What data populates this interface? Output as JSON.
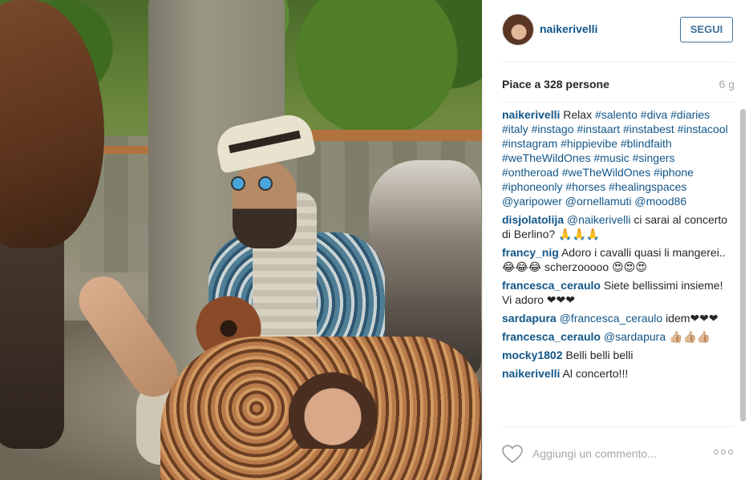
{
  "post": {
    "username": "naikerivelli",
    "follow_label": "SEGUI",
    "likes_label": "Piace a 328 persone",
    "age_label": "6 g"
  },
  "caption": {
    "user": "naikerivelli",
    "text": "Relax",
    "tags": "#salento #diva #diaries #italy #instago #instaart #instabest #instacool #instagram #hippievibe #blindfaith #weTheWildOnes #music #singers #ontheroad #weTheWildOnes #iphone #iphoneonly #horses #healingspaces @yaripower @ornellamuti @mood86"
  },
  "comments": [
    {
      "user": "disjolatolija",
      "mention": "@naikerivelli",
      "text": "ci sarai al concerto di Berlino? 🙏🙏🙏"
    },
    {
      "user": "francy_nig",
      "mention": "",
      "text": "Adoro i cavalli quasi li mangerei.. 😂😂😂 scherzooooo 😍😍😍"
    },
    {
      "user": "francesca_ceraulo",
      "mention": "",
      "text": "Siete bellissimi insieme! Vi adoro ❤❤❤"
    },
    {
      "user": "sardapura",
      "mention": "@francesca_ceraulo",
      "text": "idem❤❤❤"
    },
    {
      "user": "francesca_ceraulo",
      "mention": "@sardapura",
      "text": "👍🏼👍🏼👍🏼"
    },
    {
      "user": "mocky1802",
      "mention": "",
      "text": "Belli belli belli"
    },
    {
      "user": "naikerivelli",
      "mention": "",
      "text": "Al concerto!!!"
    }
  ],
  "footer": {
    "comment_placeholder": "Aggiungi un commento...",
    "heart_icon": "heart-outline-icon",
    "more_icon": "more-options-icon"
  },
  "colors": {
    "link": "#125688",
    "follow": "#3f729b",
    "muted": "#a5a7aa"
  }
}
